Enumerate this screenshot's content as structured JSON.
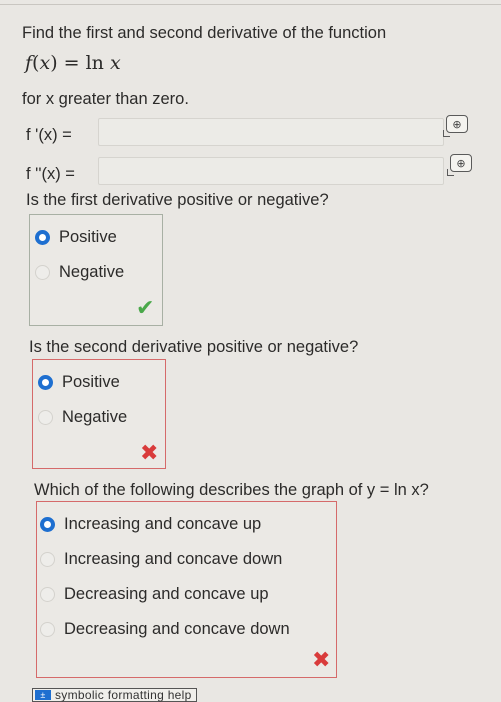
{
  "question": {
    "prompt": "Find the first and second derivative of the function",
    "func_f": "f",
    "func_lp": "(",
    "func_x": "x",
    "func_rp": ")",
    "func_eq": " = ",
    "func_ln": "ln",
    "func_arg": "x",
    "condition": "for x greater than zero."
  },
  "inputs": {
    "first_label": "f '(x) =",
    "second_label": "f ''(x) =",
    "first_value": "",
    "second_value": ""
  },
  "q1": {
    "text": "Is the first derivative positive or negative?",
    "options": [
      "Positive",
      "Negative"
    ],
    "selected": "Positive",
    "feedback": "✔"
  },
  "q2": {
    "text": "Is the second derivative positive or negative?",
    "options": [
      "Positive",
      "Negative"
    ],
    "selected": "Positive",
    "feedback": "✖"
  },
  "q3": {
    "text": "Which of the following describes the graph of y = ln x?",
    "options": [
      "Increasing and concave up",
      "Increasing and concave down",
      "Decreasing and concave up",
      "Decreasing and concave down"
    ],
    "selected": "Increasing and concave up",
    "feedback": "✖"
  },
  "help": {
    "label": "symbolic formatting help",
    "icon_glyph": "±"
  },
  "colors": {
    "radio_selected": "#1e6fd0",
    "correct": "#4aa84a",
    "incorrect": "#d93b3b"
  }
}
